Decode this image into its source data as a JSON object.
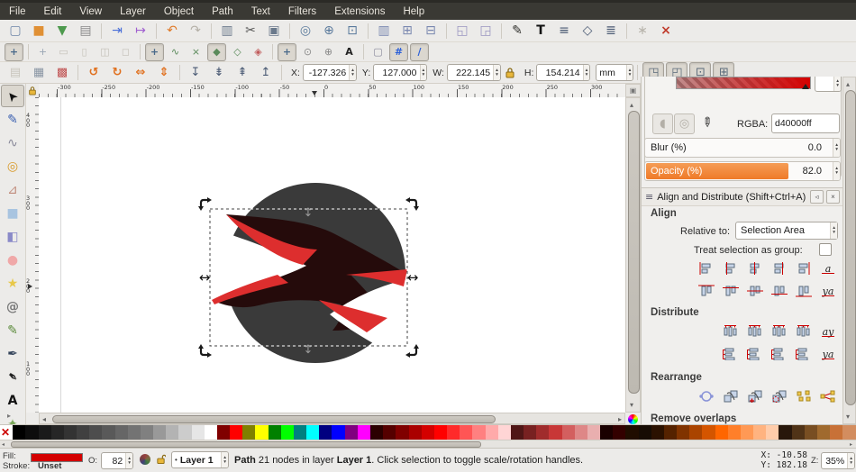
{
  "menu": {
    "items": [
      "File",
      "Edit",
      "View",
      "Layer",
      "Object",
      "Path",
      "Text",
      "Filters",
      "Extensions",
      "Help"
    ]
  },
  "ui": {
    "spin_up": "▴",
    "spin_down": "▾",
    "arrow_left": "◂",
    "arrow_right": "▸",
    "arrow_up": "▴",
    "arrow_down": "▾",
    "grip": "≡",
    "dock_btn": "◃",
    "close_btn": "×",
    "overflow": "▸",
    "bullet": "•"
  },
  "toolbars": {
    "commands": [
      {
        "n": "new-document-icon",
        "g": "▢",
        "c": "#6f87a8"
      },
      {
        "n": "open-document-icon",
        "g": "■",
        "c": "#e09035"
      },
      {
        "n": "save-icon",
        "g": "▼",
        "c": "#4e9a4e"
      },
      {
        "n": "print-icon",
        "g": "▤",
        "c": "#8a8a8a"
      },
      {
        "sep": true
      },
      {
        "n": "import-icon",
        "g": "⇥",
        "c": "#4a6fd8"
      },
      {
        "n": "export-icon",
        "g": "↦",
        "c": "#a05fd0"
      },
      {
        "sep": true
      },
      {
        "n": "undo-icon",
        "g": "↶",
        "c": "#e07b2a"
      },
      {
        "n": "redo-icon",
        "g": "↷",
        "c": "#b5b1a8"
      },
      {
        "sep": true
      },
      {
        "n": "copy-icon",
        "g": "▥",
        "c": "#6b7a8c"
      },
      {
        "n": "cut-icon",
        "g": "✂",
        "c": "#555555"
      },
      {
        "n": "paste-icon",
        "g": "▣",
        "c": "#6b7a8c"
      },
      {
        "sep": true
      },
      {
        "n": "zoom-selection-icon",
        "g": "◎",
        "c": "#5a7a9c"
      },
      {
        "n": "zoom-drawing-icon",
        "g": "⊕",
        "c": "#5a7a9c"
      },
      {
        "n": "zoom-page-icon",
        "g": "⊡",
        "c": "#5a7a9c"
      },
      {
        "sep": true
      },
      {
        "n": "duplicate-icon",
        "g": "▥",
        "c": "#7a88b0"
      },
      {
        "n": "create-clone-icon",
        "g": "⊞",
        "c": "#7a88b0"
      },
      {
        "n": "unlink-clone-icon",
        "g": "⊟",
        "c": "#7a88b0"
      },
      {
        "sep": true
      },
      {
        "n": "select-original-icon",
        "g": "◱",
        "c": "#9a96c0"
      },
      {
        "n": "group-icon",
        "g": "◲",
        "c": "#9a96c0"
      },
      {
        "sep": true
      },
      {
        "n": "fill-stroke-dialog-icon",
        "g": "✎",
        "c": "#30302c"
      },
      {
        "n": "text-dialog-icon",
        "g": "T",
        "c": "#111111",
        "b": 1
      },
      {
        "n": "layers-dialog-icon",
        "g": "≡",
        "c": "#4a5a74"
      },
      {
        "n": "xml-editor-icon",
        "g": "◇",
        "c": "#4a5a74"
      },
      {
        "n": "align-dialog-icon",
        "g": "≣",
        "c": "#4a5a74"
      },
      {
        "sep": true
      },
      {
        "n": "preferences-gear-icon",
        "g": "∗",
        "c": "#b8b4ac"
      },
      {
        "n": "input-devices-icon",
        "g": "×",
        "c": "#c03a2a",
        "b": 1
      }
    ],
    "snap": [
      {
        "n": "snap-enable-icon",
        "g": "+",
        "c": "#4a6a8a",
        "s": 1,
        "b": 1
      },
      {
        "sep": true
      },
      {
        "n": "snap-bbox-icon",
        "g": "+",
        "c": "#9aa6b4"
      },
      {
        "n": "snap-bbox-edge-icon",
        "g": "▭",
        "c": "#c4c0b8"
      },
      {
        "n": "snap-bbox-corner-icon",
        "g": "▯",
        "c": "#c4c0b8"
      },
      {
        "n": "snap-bbox-edge-mid-icon",
        "g": "◫",
        "c": "#c4c0b8"
      },
      {
        "n": "snap-bbox-center-icon",
        "g": "◻",
        "c": "#c4c0b8"
      },
      {
        "sep": true
      },
      {
        "n": "snap-nodes-icon",
        "g": "+",
        "c": "#4a6a8a",
        "s": 1,
        "b": 1
      },
      {
        "n": "snap-path-icon",
        "g": "∿",
        "c": "#5a8a5a"
      },
      {
        "n": "snap-intersection-icon",
        "g": "×",
        "c": "#5a8a5a"
      },
      {
        "n": "snap-cusp-node-icon",
        "g": "◆",
        "c": "#5a8a5a",
        "s": 1
      },
      {
        "n": "snap-smooth-node-icon",
        "g": "◇",
        "c": "#5a8a5a"
      },
      {
        "n": "snap-midpoint-icon",
        "g": "◈",
        "c": "#c05a5a"
      },
      {
        "sep": true
      },
      {
        "n": "snap-others-icon",
        "g": "+",
        "c": "#4a6a8a",
        "s": 1,
        "b": 1
      },
      {
        "n": "snap-object-center-icon",
        "g": "⊙",
        "c": "#8a8a8a"
      },
      {
        "n": "snap-rotation-center-icon",
        "g": "⊕",
        "c": "#8a8a8a"
      },
      {
        "n": "snap-text-baseline-icon",
        "g": "A",
        "c": "#222222",
        "b": 1
      },
      {
        "sep": true
      },
      {
        "n": "snap-page-border-icon",
        "g": "▢",
        "c": "#8a8a9c"
      },
      {
        "n": "snap-grid-icon",
        "g": "#",
        "c": "#2b5fd8",
        "s": 1,
        "b": 1
      },
      {
        "n": "snap-guide-icon",
        "g": "∕",
        "c": "#2b5fd8",
        "s": 1,
        "b": 1
      }
    ],
    "options_left": [
      {
        "n": "select-all-icon",
        "g": "▤",
        "c": "#c8c4bc"
      },
      {
        "n": "select-all-layers-icon",
        "g": "▦",
        "c": "#8a96a4"
      },
      {
        "n": "deselect-icon",
        "g": "▩",
        "c": "#c05050"
      },
      {
        "sep": true
      },
      {
        "n": "rotate-ccw-icon",
        "g": "↺",
        "c": "#e0701e",
        "b": 1
      },
      {
        "n": "rotate-cw-icon",
        "g": "↻",
        "c": "#e0701e",
        "b": 1
      },
      {
        "n": "flip-horizontal-icon",
        "g": "⇔",
        "c": "#e0701e",
        "b": 1
      },
      {
        "n": "flip-vertical-icon",
        "g": "⇕",
        "c": "#e0701e",
        "b": 1
      },
      {
        "sep": true
      },
      {
        "n": "lower-to-bottom-icon",
        "g": "↧",
        "c": "#4a5a74"
      },
      {
        "n": "lower-icon",
        "g": "⇟",
        "c": "#4a5a74"
      },
      {
        "n": "raise-icon",
        "g": "⇞",
        "c": "#4a5a74"
      },
      {
        "n": "raise-to-top-icon",
        "g": "↥",
        "c": "#4a5a74"
      }
    ],
    "options_right": [
      {
        "n": "scale-stroke-toggle-icon",
        "g": "◳",
        "c": "#5a6a7a",
        "s": 1
      },
      {
        "n": "scale-corners-toggle-icon",
        "g": "◰",
        "c": "#5a6a7a",
        "s": 1
      },
      {
        "n": "scale-gradient-toggle-icon",
        "g": "⊡",
        "c": "#5a6a7a",
        "s": 1
      },
      {
        "n": "scale-pattern-toggle-icon",
        "g": "⊞",
        "c": "#5a6a7a",
        "s": 1
      }
    ]
  },
  "tool_options": {
    "x_label": "X:",
    "x_value": "-127.326",
    "y_label": "Y:",
    "y_value": "127.000",
    "w_label": "W:",
    "w_value": "222.145",
    "h_label": "H:",
    "h_value": "154.214",
    "unit": "mm"
  },
  "toolbox": {
    "tools": [
      {
        "n": "selector-tool",
        "g": "➤",
        "c": "#111111",
        "s": 1,
        "r": -130
      },
      {
        "n": "node-editor-tool",
        "g": "✎",
        "c": "#3a5fb0"
      },
      {
        "n": "tweak-tool",
        "g": "∿",
        "c": "#8a8a9a"
      },
      {
        "n": "zoom-tool",
        "g": "◎",
        "c": "#d89a2a",
        "b": 1
      },
      {
        "n": "measure-tool",
        "g": "⊿",
        "c": "#c08a7a"
      },
      {
        "n": "rectangle-tool",
        "g": "■",
        "c": "#a8c4e0"
      },
      {
        "n": "box-3d-tool",
        "g": "◧",
        "c": "#8a8ac8"
      },
      {
        "n": "ellipse-tool",
        "g": "●",
        "c": "#f0a8a8"
      },
      {
        "n": "star-tool",
        "g": "★",
        "c": "#e8c84a"
      },
      {
        "n": "spiral-tool",
        "g": "@",
        "c": "#7a7a7a",
        "b": 1
      },
      {
        "n": "pencil-tool",
        "g": "✎",
        "c": "#5a8a3a"
      },
      {
        "n": "bezier-pen-tool",
        "g": "✒",
        "c": "#33435a"
      },
      {
        "n": "calligraphy-tool",
        "g": "✒",
        "c": "#222222",
        "r": 40
      },
      {
        "n": "text-tool",
        "g": "A",
        "c": "#111111",
        "b": 1
      },
      {
        "n": "spray-tool",
        "g": "✦",
        "c": "#7aa85a"
      }
    ]
  },
  "rulers": {
    "top_labels": [
      "-300",
      "-250",
      "-200",
      "-150",
      "-100",
      "-50",
      "0",
      "50",
      "100",
      "150",
      "200",
      "250",
      "300"
    ],
    "left_labels": [
      "400",
      "300",
      "200",
      "100"
    ]
  },
  "canvas": {
    "circle_color": "#3a3a3a",
    "bird_color": "#250b0b",
    "accent_color": "#dd2e2e",
    "background": "#ffffff"
  },
  "dock": {
    "fill_stroke": {
      "rgba_label": "RGBA:",
      "rgba_value": "d40000ff",
      "blur_label": "Blur (%)",
      "blur_value": "0.0",
      "opacity_label": "Opacity (%)",
      "opacity_value": "82.0",
      "opacity_fill_color": "#ef7a28"
    },
    "align": {
      "title": "Align and Distribute (Shift+Ctrl+A)",
      "align_header": "Align",
      "relative_label": "Relative to:",
      "relative_value": "Selection Area",
      "treat_label": "Treat selection as group:",
      "distribute_header": "Distribute",
      "rearrange_header": "Rearrange",
      "remove_overlaps_header": "Remove overlaps",
      "row1": [
        {
          "n": "align-right-to-left-edge-icon",
          "t": "ah",
          "v": 0
        },
        {
          "n": "align-left-edges-icon",
          "t": "ah",
          "v": 1
        },
        {
          "n": "align-center-vertical-axis-icon",
          "t": "ah",
          "v": 2
        },
        {
          "n": "align-right-edges-icon",
          "t": "ah",
          "v": 3
        },
        {
          "n": "align-left-to-right-edge-icon",
          "t": "ah",
          "v": 4
        },
        {
          "n": "align-text-anchor-horizontal-icon",
          "t": "txt",
          "g": "a"
        }
      ],
      "row2": [
        {
          "n": "align-bottom-to-top-edge-icon",
          "t": "av",
          "v": 0
        },
        {
          "n": "align-top-edges-icon",
          "t": "av",
          "v": 1
        },
        {
          "n": "align-center-horizontal-axis-icon",
          "t": "av",
          "v": 2
        },
        {
          "n": "align-bottom-edges-icon",
          "t": "av",
          "v": 3
        },
        {
          "n": "align-top-to-bottom-edge-icon",
          "t": "av",
          "v": 4
        },
        {
          "n": "align-text-anchor-vertical-icon",
          "t": "txt",
          "g": "ya"
        }
      ],
      "dist1": [
        {
          "n": "distribute-left-edges-icon",
          "t": "dh",
          "v": 0
        },
        {
          "n": "distribute-centers-horizontal-icon",
          "t": "dh",
          "v": 1
        },
        {
          "n": "distribute-right-edges-icon",
          "t": "dh",
          "v": 2
        },
        {
          "n": "distribute-horizontal-gaps-icon",
          "t": "dh",
          "v": 3
        },
        {
          "n": "distribute-text-anchors-horizontal-icon",
          "t": "txt",
          "g": "ay"
        }
      ],
      "dist2": [
        {
          "n": "distribute-top-edges-icon",
          "t": "dv",
          "v": 0
        },
        {
          "n": "distribute-centers-vertical-icon",
          "t": "dv",
          "v": 1
        },
        {
          "n": "distribute-bottom-edges-icon",
          "t": "dv",
          "v": 2
        },
        {
          "n": "distribute-vertical-gaps-icon",
          "t": "dv",
          "v": 3
        },
        {
          "n": "distribute-text-anchors-vertical-icon",
          "t": "txt",
          "g": "ya"
        }
      ],
      "rearrange_row": [
        {
          "n": "graph-layout-icon",
          "t": "hex"
        },
        {
          "n": "exchange-positions-icon",
          "t": "sq"
        },
        {
          "n": "exchange-zorder-icon",
          "t": "sqa"
        },
        {
          "n": "exchange-clockwise-icon",
          "t": "sqc"
        },
        {
          "n": "randomize-positions-icon",
          "t": "scat"
        },
        {
          "n": "unclump-icon",
          "t": "net"
        }
      ]
    }
  },
  "palette": {
    "colors": [
      "none",
      "#000000",
      "#0d0d0d",
      "#1a1a1a",
      "#262626",
      "#333333",
      "#404040",
      "#4d4d4d",
      "#595959",
      "#666666",
      "#737373",
      "#808080",
      "#999999",
      "#b3b3b3",
      "#cccccc",
      "#e6e6e6",
      "#ffffff",
      "#800000",
      "#ff0000",
      "#808000",
      "#ffff00",
      "#008000",
      "#00ff00",
      "#008080",
      "#00ffff",
      "#000080",
      "#0000ff",
      "#800080",
      "#ff00ff",
      "#2b0000",
      "#550000",
      "#800000",
      "#aa0000",
      "#d40000",
      "#ff0000",
      "#ff2a2a",
      "#ff5555",
      "#ff8080",
      "#ffaaaa",
      "#ffd5d5",
      "#501616",
      "#782121",
      "#a02c2c",
      "#c83737",
      "#d35f5f",
      "#de8787",
      "#e9afaf",
      "#1a0000",
      "#330000",
      "#200d00",
      "#170c04",
      "#2b1100",
      "#552200",
      "#803300",
      "#aa4400",
      "#d45500",
      "#ff6600",
      "#ff7f2a",
      "#ff9955",
      "#ffb380",
      "#ffccaa",
      "#28170b",
      "#503317",
      "#784e22",
      "#a06a2e",
      "#c87137",
      "#d38d5f"
    ]
  },
  "status_bar": {
    "fill_label": "Fill:",
    "fill_color": "#d40000",
    "stroke_label": "Stroke:",
    "stroke_value": "Unset",
    "opacity_label": "O:",
    "opacity_value": "82",
    "layer_value": "Layer 1",
    "msg_bold1": "Path",
    "msg_mid": " 21 nodes in layer ",
    "msg_bold2": "Layer 1",
    "msg_tail": ". Click selection to toggle scale/rotation handles.",
    "x_label": "X:",
    "x_value": "-10.58",
    "y_label": "Y:",
    "y_value": "182.18",
    "zoom_label": "Z:",
    "zoom_value": "35%"
  }
}
